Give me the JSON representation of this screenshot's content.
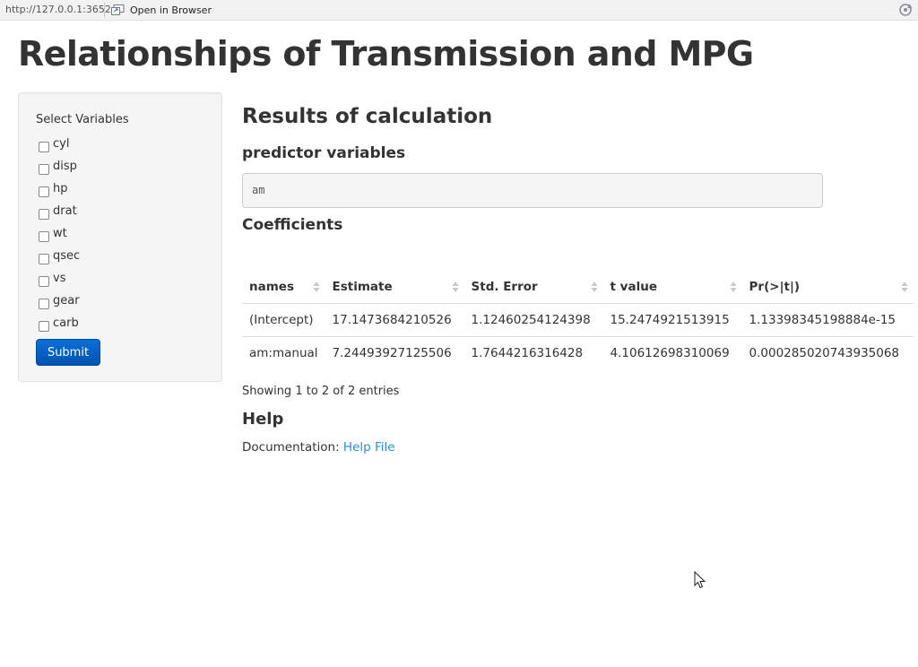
{
  "browser": {
    "url": "http://127.0.0.1:3652",
    "open_label": "Open in Browser"
  },
  "page": {
    "title": "Relationships of Transmission and MPG"
  },
  "sidebar": {
    "label": "Select Variables",
    "checkboxes": [
      {
        "label": "cyl",
        "checked": false
      },
      {
        "label": "disp",
        "checked": false
      },
      {
        "label": "hp",
        "checked": false
      },
      {
        "label": "drat",
        "checked": false
      },
      {
        "label": "wt",
        "checked": false
      },
      {
        "label": "qsec",
        "checked": false
      },
      {
        "label": "vs",
        "checked": false
      },
      {
        "label": "gear",
        "checked": false
      },
      {
        "label": "carb",
        "checked": false
      }
    ],
    "submit_label": "Submit"
  },
  "main": {
    "results_heading": "Results of calculation",
    "predictor_heading": "predictor variables",
    "predictor_value": "am",
    "coef_heading": "Coefficients",
    "table": {
      "headers": [
        "names",
        "Estimate",
        "Std. Error",
        "t value",
        "Pr(>|t|)"
      ],
      "rows": [
        [
          "(Intercept)",
          "17.1473684210526",
          "1.12460254124398",
          "15.2474921513915",
          "1.13398345198884e-15"
        ],
        [
          "am:manual",
          "7.24493927125506",
          "1.7644216316428",
          "4.10612698310069",
          "0.000285020743935068"
        ]
      ]
    },
    "info": "Showing 1 to 2 of 2 entries",
    "help_heading": "Help",
    "doc_label": "Documentation:",
    "doc_link": "Help File"
  },
  "colors": {
    "submit_bg": "#0a6fd8",
    "link": "#2a8fcf",
    "sidebar_bg": "#f5f5f5"
  }
}
